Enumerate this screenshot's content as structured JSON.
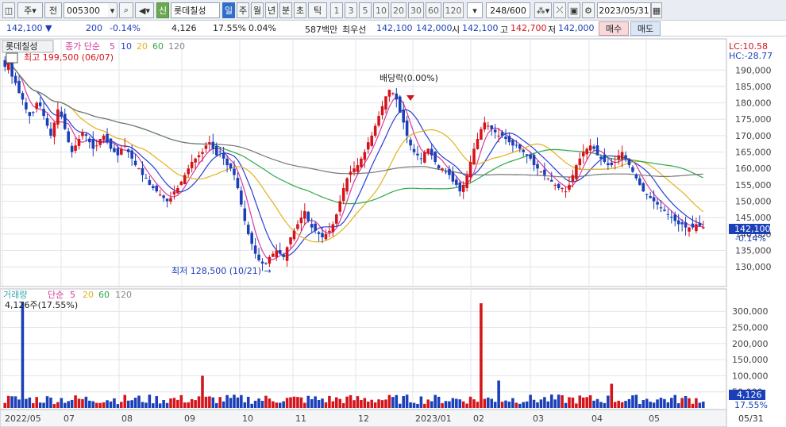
{
  "toolbar": {
    "market_code": "주",
    "prev_label": "전",
    "code": "005300",
    "stock_badge": "신",
    "stock_name": "롯데칠성",
    "periods": [
      "일",
      "주",
      "월",
      "년",
      "분",
      "초",
      "틱"
    ],
    "active_period": "일",
    "counts": [
      "1",
      "3",
      "5",
      "10",
      "20",
      "30",
      "60",
      "120"
    ],
    "count_display": "248/600",
    "date": "2023/05/31"
  },
  "quote": {
    "price": "142,100 ▼",
    "change": "200",
    "change_pct": "-0.14%",
    "volume": "4,126",
    "volume_pct": "17.55%",
    "vol_pct2": "0.04%",
    "amount": "587백만",
    "best_label": "최우선",
    "best_ask": "142,100",
    "best_bid": "142,000",
    "open_label": "시",
    "open": "142,100",
    "high_label": "고",
    "high": "142,700",
    "low_label": "저",
    "low": "142,000",
    "sell_label": "매수",
    "buy_label": "매도"
  },
  "price_panel": {
    "name_label": "롯데칠성",
    "ma_label": "종가 단순",
    "ma_periods": [
      "5",
      "10",
      "20",
      "60",
      "120"
    ],
    "ma_colors": [
      "#d63aa0",
      "#2a3dd6",
      "#e3b21a",
      "#2fa84a",
      "#777777"
    ],
    "high_note": "최고 199,500 (06/07)",
    "low_note": "최저 128,500 (10/21) →",
    "dividend_note": "배당락(0.00%)",
    "lc_label": "LC:10.58",
    "hc_label": "HC:-28.77",
    "current_price": "142,100",
    "current_change": "-0.14%",
    "y_ticks": [
      "190,000",
      "185,000",
      "180,000",
      "175,000",
      "170,000",
      "165,000",
      "160,000",
      "155,000",
      "150,000",
      "145,000",
      "140,000",
      "135,000",
      "130,000"
    ]
  },
  "volume_panel": {
    "name_label": "거래량",
    "ma_label": "단순",
    "ma_periods": [
      "5",
      "20",
      "60",
      "120"
    ],
    "vol_note": "4,126주(17.55%)",
    "current_volume": "4,126",
    "current_pct": "17.55%",
    "y_ticks": [
      "300,000",
      "250,000",
      "200,000",
      "150,000",
      "100,000",
      "50,000"
    ]
  },
  "x_axis": {
    "labels": [
      "2022/05",
      "07",
      "08",
      "09",
      "10",
      "11",
      "12",
      "2023/01",
      "02",
      "03",
      "04",
      "05"
    ],
    "end_label": "05/31"
  },
  "colors": {
    "up": "#d4141b",
    "down": "#1a3fb8",
    "grid": "#e2e4e8"
  },
  "chart_data": {
    "type": "candlestick",
    "closes": [
      191000,
      195000,
      188000,
      186000,
      183000,
      181000,
      178000,
      176000,
      177000,
      180000,
      179000,
      176000,
      173000,
      170000,
      174000,
      178000,
      176000,
      172000,
      168000,
      165000,
      167000,
      169000,
      171000,
      170000,
      168000,
      166000,
      167000,
      169000,
      170000,
      168000,
      166000,
      165000,
      164000,
      166000,
      167000,
      165000,
      163000,
      161000,
      160000,
      158000,
      157000,
      155000,
      154000,
      153000,
      152000,
      151000,
      150000,
      151000,
      153000,
      154000,
      156000,
      158000,
      160000,
      162000,
      163000,
      164000,
      165000,
      167000,
      168000,
      166000,
      164000,
      165000,
      163000,
      161000,
      160000,
      158000,
      154000,
      149000,
      144000,
      140000,
      137000,
      134000,
      132000,
      131000,
      131000,
      133000,
      134000,
      135000,
      134000,
      133000,
      136000,
      139000,
      141000,
      143000,
      145000,
      147000,
      144000,
      142000,
      141000,
      140000,
      139000,
      140000,
      141000,
      143000,
      146000,
      150000,
      154000,
      157000,
      159000,
      160000,
      161000,
      163000,
      165000,
      168000,
      170000,
      173000,
      176000,
      179000,
      182000,
      184000,
      183000,
      181000,
      177000,
      174000,
      170000,
      167000,
      165000,
      164000,
      163000,
      165000,
      166000,
      164000,
      162000,
      160000,
      160000,
      159000,
      158000,
      156000,
      155000,
      153000,
      155000,
      158000,
      162000,
      166000,
      169000,
      172000,
      174000,
      173000,
      172000,
      171000,
      170000,
      170000,
      169000,
      168000,
      167000,
      167000,
      166000,
      165000,
      164000,
      163000,
      161000,
      160000,
      159000,
      158000,
      157000,
      156000,
      155000,
      154000,
      154000,
      153000,
      155000,
      158000,
      161000,
      163000,
      165000,
      166000,
      167000,
      166000,
      164000,
      163000,
      162000,
      161000,
      161000,
      162000,
      164000,
      165000,
      163000,
      161000,
      159000,
      157000,
      155000,
      153000,
      152000,
      151000,
      150000,
      149000,
      148000,
      147000,
      146000,
      145000,
      144000,
      143000,
      143000,
      142000,
      142000,
      142000,
      143000,
      142500,
      142100
    ]
  }
}
